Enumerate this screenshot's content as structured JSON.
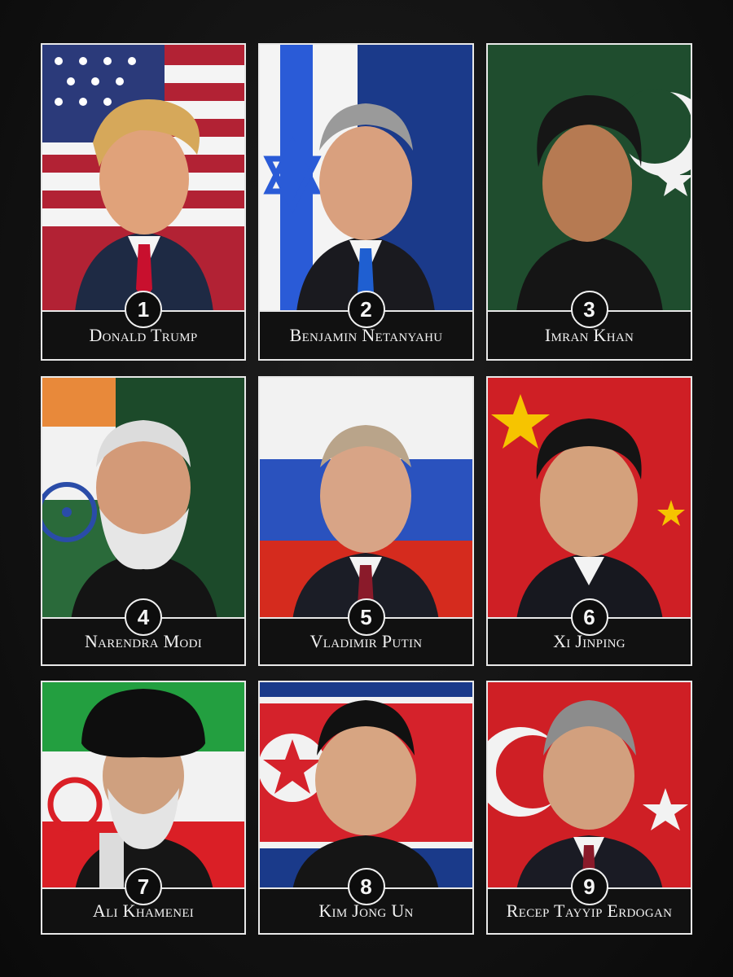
{
  "colors": {
    "background": "#141414",
    "frame": "#e8e8e8",
    "nameplate": "#111111"
  },
  "cards": [
    {
      "number": "1",
      "name": "Donald Trump",
      "flag": "usa-flag-icon"
    },
    {
      "number": "2",
      "name": "Benjamin Netanyahu",
      "flag": "israel-flag-icon"
    },
    {
      "number": "3",
      "name": "Imran Khan",
      "flag": "pakistan-flag-icon"
    },
    {
      "number": "4",
      "name": "Narendra Modi",
      "flag": "india-flag-icon"
    },
    {
      "number": "5",
      "name": "Vladimir Putin",
      "flag": "russia-flag-icon"
    },
    {
      "number": "6",
      "name": "Xi Jinping",
      "flag": "china-flag-icon"
    },
    {
      "number": "7",
      "name": "Ali Khamenei",
      "flag": "iran-flag-icon"
    },
    {
      "number": "8",
      "name": "Kim Jong Un",
      "flag": "north-korea-flag-icon"
    },
    {
      "number": "9",
      "name": "Recep Tayyip Erdogan",
      "flag": "turkey-flag-icon"
    }
  ]
}
